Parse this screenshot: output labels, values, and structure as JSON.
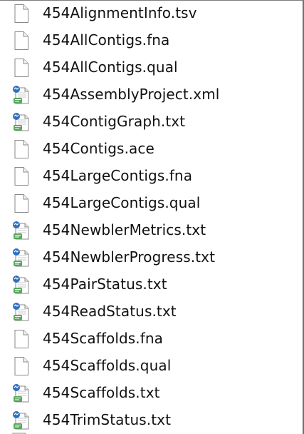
{
  "files": [
    {
      "name": "454AlignmentInfo.tsv",
      "icon": "document-icon"
    },
    {
      "name": "454AllContigs.fna",
      "icon": "document-icon"
    },
    {
      "name": "454AllContigs.qual",
      "icon": "document-icon"
    },
    {
      "name": "454AssemblyProject.xml",
      "icon": "text-document-icon"
    },
    {
      "name": "454ContigGraph.txt",
      "icon": "text-document-icon"
    },
    {
      "name": "454Contigs.ace",
      "icon": "document-icon"
    },
    {
      "name": "454LargeContigs.fna",
      "icon": "document-icon"
    },
    {
      "name": "454LargeContigs.qual",
      "icon": "document-icon"
    },
    {
      "name": "454NewblerMetrics.txt",
      "icon": "text-document-icon"
    },
    {
      "name": "454NewblerProgress.txt",
      "icon": "text-document-icon"
    },
    {
      "name": "454PairStatus.txt",
      "icon": "text-document-icon"
    },
    {
      "name": "454ReadStatus.txt",
      "icon": "text-document-icon"
    },
    {
      "name": "454Scaffolds.fna",
      "icon": "document-icon"
    },
    {
      "name": "454Scaffolds.qual",
      "icon": "document-icon"
    },
    {
      "name": "454Scaffolds.txt",
      "icon": "text-document-icon"
    },
    {
      "name": "454TrimStatus.txt",
      "icon": "text-document-icon"
    }
  ],
  "colors": {
    "text": "#111111",
    "background": "#ffffff",
    "icon_outline": "#8a8a8a",
    "icon_text_blue": "#2f6fc0",
    "icon_text_green": "#3e9a43"
  }
}
